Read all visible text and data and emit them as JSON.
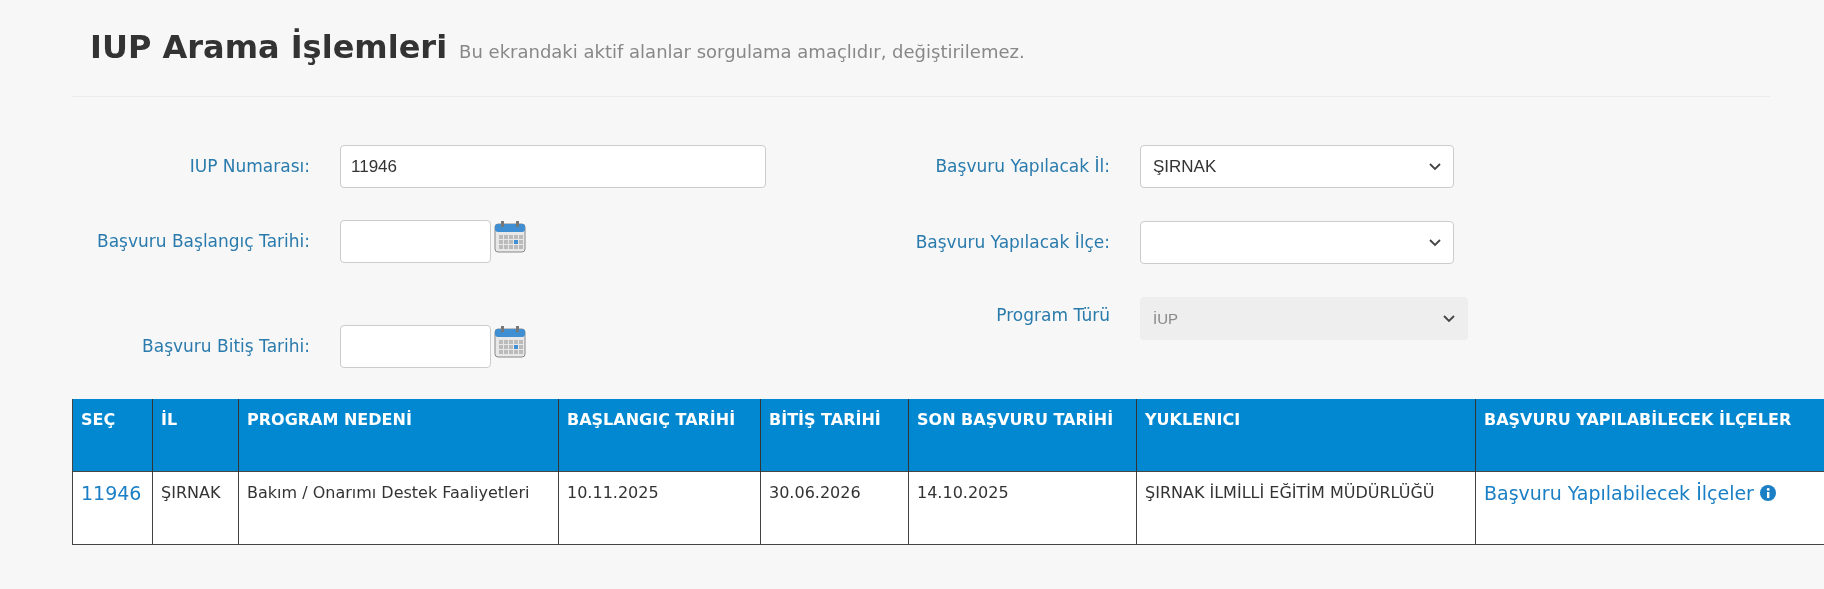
{
  "header": {
    "title": "IUP Arama İşlemleri",
    "subtitle": "Bu ekrandaki aktif alanlar sorgulama amaçlıdır, değiştirilemez."
  },
  "form": {
    "left": [
      {
        "label": "IUP Numarası:",
        "kind": "text",
        "value": "11946"
      },
      {
        "label": "Başvuru Başlangıç Tarihi:",
        "kind": "date"
      },
      {
        "label": "Başvuru Bitiş Tarihi:",
        "kind": "date"
      }
    ],
    "right": [
      {
        "label": "Başvuru Yapılacak İl:",
        "kind": "select",
        "value": "ŞIRNAK",
        "disabled": false
      },
      {
        "label": "Başvuru Yapılacak İlçe:",
        "kind": "select",
        "disabled": false
      },
      {
        "label": "Program Türü",
        "kind": "select",
        "value": "İUP",
        "disabled": true
      }
    ]
  },
  "table": {
    "columns": [
      "SEÇ",
      "İL",
      "PROGRAM NEDENİ",
      "BAŞLANGIÇ TARİHİ",
      "BİTİŞ TARİHİ",
      "SON BAŞVURU TARİHİ",
      "YUKLENICI",
      "BAŞVURU YAPILABİLECEK İLÇELER"
    ],
    "rows": [
      {
        "cells": [
          "11946",
          "ŞIRNAK",
          "Bakım / Onarımı Destek Faaliyetleri",
          "10.11.2025",
          "30.06.2026",
          "14.10.2025",
          "ŞIRNAK İLMİLLİ EĞİTİM MÜDÜRLÜĞÜ",
          "Başvuru Yapılabilecek İlçeler"
        ]
      }
    ]
  }
}
